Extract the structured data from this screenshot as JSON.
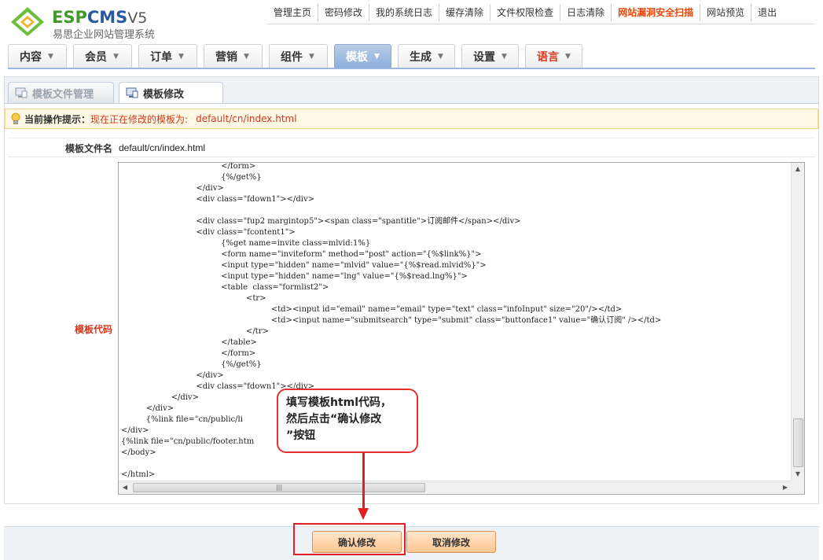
{
  "logo": {
    "brand_part1": "ESP",
    "brand_part2": "CMS",
    "brand_version": "V5",
    "subtitle": "易思企业网站管理系统"
  },
  "topnav": [
    {
      "label": "管理主页"
    },
    {
      "label": "密码修改"
    },
    {
      "label": "我的系统日志"
    },
    {
      "label": "缓存清除"
    },
    {
      "label": "文件权限检查"
    },
    {
      "label": "日志清除"
    },
    {
      "label": "网站漏洞安全扫描"
    },
    {
      "label": "网站预览"
    },
    {
      "label": "退出"
    }
  ],
  "mainmenu": [
    {
      "label": "内容"
    },
    {
      "label": "会员"
    },
    {
      "label": "订单"
    },
    {
      "label": "营销"
    },
    {
      "label": "组件"
    },
    {
      "label": "模板"
    },
    {
      "label": "生成"
    },
    {
      "label": "设置"
    },
    {
      "label": "语言"
    }
  ],
  "subtabs": {
    "tab1": "模板文件管理",
    "tab2": "模板修改"
  },
  "hint": {
    "label": "当前操作提示：",
    "message": "现在正在修改的模板为:",
    "path": "default/cn/index.html"
  },
  "form": {
    "filename_label": "模板文件名",
    "filename_value": "default/cn/index.html",
    "code_label": "模板代码",
    "code_lines": [
      "                                        </form>",
      "                                        {%/get%}",
      "                              </div>",
      "                              <div class=\"fdown1\"></div>",
      "",
      "                              <div class=\"fup2 margintop5\"><span class=\"spantitle\">订阅邮件</span></div>",
      "                              <div class=\"fcontent1\">",
      "                                        {%get name=invite class=mlvid:1%}",
      "                                        <form name=\"inviteform\" method=\"post\" action=\"{%$link%}\">",
      "                                        <input type=\"hidden\" name=\"mlvid\" value=\"{%$read.mlvid%}\">",
      "                                        <input type=\"hidden\" name=\"lng\" value=\"{%$read.lng%}\">",
      "                                        <table  class=\"formlist2\">",
      "                                                  <tr>",
      "                                                            <td><input id=\"email\" name=\"email\" type=\"text\" class=\"infoInput\" size=\"20\"/></td>",
      "                                                            <td><input name=\"submitsearch\" type=\"submit\" class=\"buttonface1\" value=\"确认订阅\" /></td>",
      "                                                  </tr>",
      "                                        </table>",
      "                                        </form>",
      "                                        {%/get%}",
      "                              </div>",
      "                              <div class=\"fdown1\"></div>",
      "                    </div>",
      "          </div>",
      "          {%link file=\"cn/public/li",
      "</div>",
      "{%link file=\"cn/public/footer.htm",
      "</body>",
      "",
      "</html>"
    ]
  },
  "callout": {
    "line1": "填写模板html代码，",
    "line2": "然后点击“确认修改",
    "line3": "”按钮"
  },
  "buttons": {
    "confirm": "确认修改",
    "cancel": "取消修改"
  },
  "colors": {
    "accent_red": "#e02020",
    "menu_active": "#8eb0dc",
    "alert_orange": "#e8470b",
    "button_orange": "#ffc58f"
  }
}
